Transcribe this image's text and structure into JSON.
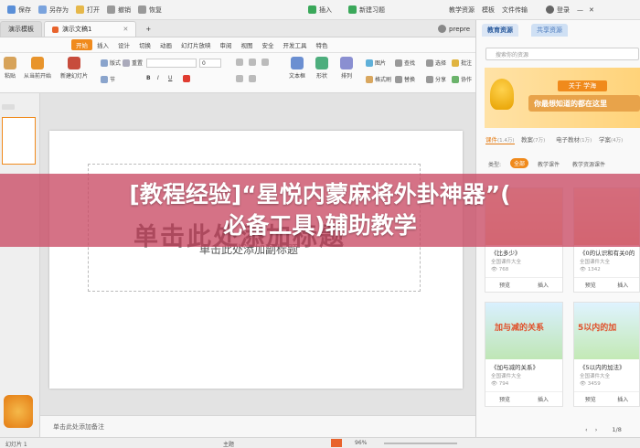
{
  "titlebar": {
    "save": "保存",
    "save_as": "另存为",
    "open": "打开",
    "undo": "撤销",
    "redo": "恢复",
    "insert": "插入",
    "new_lesson": "新建习题",
    "login": "登录",
    "resource_center": "教学资源",
    "templates": "模板",
    "file_mgr": "文件传输"
  },
  "tabs": {
    "home_tab": "演示模板",
    "doc_tab": "演示文稿1",
    "user": "prepre"
  },
  "ribbon_tabs": [
    "开始",
    "插入",
    "设计",
    "切换",
    "动画",
    "幻灯片放映",
    "审阅",
    "视图",
    "安全",
    "开发工具",
    "特色"
  ],
  "ribbon": {
    "paste": "粘贴",
    "new_slide": "新建幻灯片",
    "layout": "版式",
    "section": "节",
    "reset": "重置",
    "from_current": "从当前开始",
    "font_size": "0",
    "textbox": "文本框",
    "shape": "形状",
    "arrange": "排列",
    "picture": "图片",
    "replace": "替换",
    "select": "选择",
    "format": "格式刷",
    "find": "查找",
    "comment": "批注",
    "collab": "协作",
    "share": "分享"
  },
  "slide": {
    "title_placeholder": "单击此处添加标题",
    "subtitle_placeholder": "单击此处添加副标题",
    "notes_placeholder": "单击此处添加备注"
  },
  "overlay": {
    "line1": "[教程经验]“星悦内蒙麻将外卦神器”(",
    "line2": "必备工具)辅助教学"
  },
  "status": {
    "slide_info": "幻灯片 1",
    "theme": "主题",
    "zoom": "96%"
  },
  "panel": {
    "tab1": "教育资源",
    "tab2": "共享资源",
    "search_placeholder": "搜索你的资源",
    "banner_head": "关于 学海",
    "banner_text": "你最想知道的都在这里",
    "categories": [
      {
        "label": "课件",
        "count": "(1.4万)"
      },
      {
        "label": "教案",
        "count": "(7万)"
      },
      {
        "label": "电子教材",
        "count": "(1万)"
      },
      {
        "label": "学案",
        "count": "(4万)"
      }
    ],
    "filter_label": "类型:",
    "filter_all": "全部",
    "filter_a": "教学课件",
    "filter_b": "教学资源课件",
    "cards": [
      {
        "title": "《比多少》",
        "source": "全国课件大全",
        "count": "768",
        "preview": "预览",
        "insert": "插入"
      },
      {
        "title": "《0的认识和有关0的",
        "source": "全国课件大全",
        "count": "1342",
        "preview": "预览",
        "insert": "插入"
      },
      {
        "title": "《加与减的关系》",
        "source": "全国课件大全",
        "count": "794",
        "preview": "预览",
        "insert": "插入"
      },
      {
        "title": "《5以内的加法》",
        "source": "全国课件大全",
        "count": "3459",
        "preview": "预览",
        "insert": "插入"
      }
    ],
    "card3_headline": "加与减的关系",
    "card4_headline": "5以内的加",
    "page": "1/8"
  }
}
